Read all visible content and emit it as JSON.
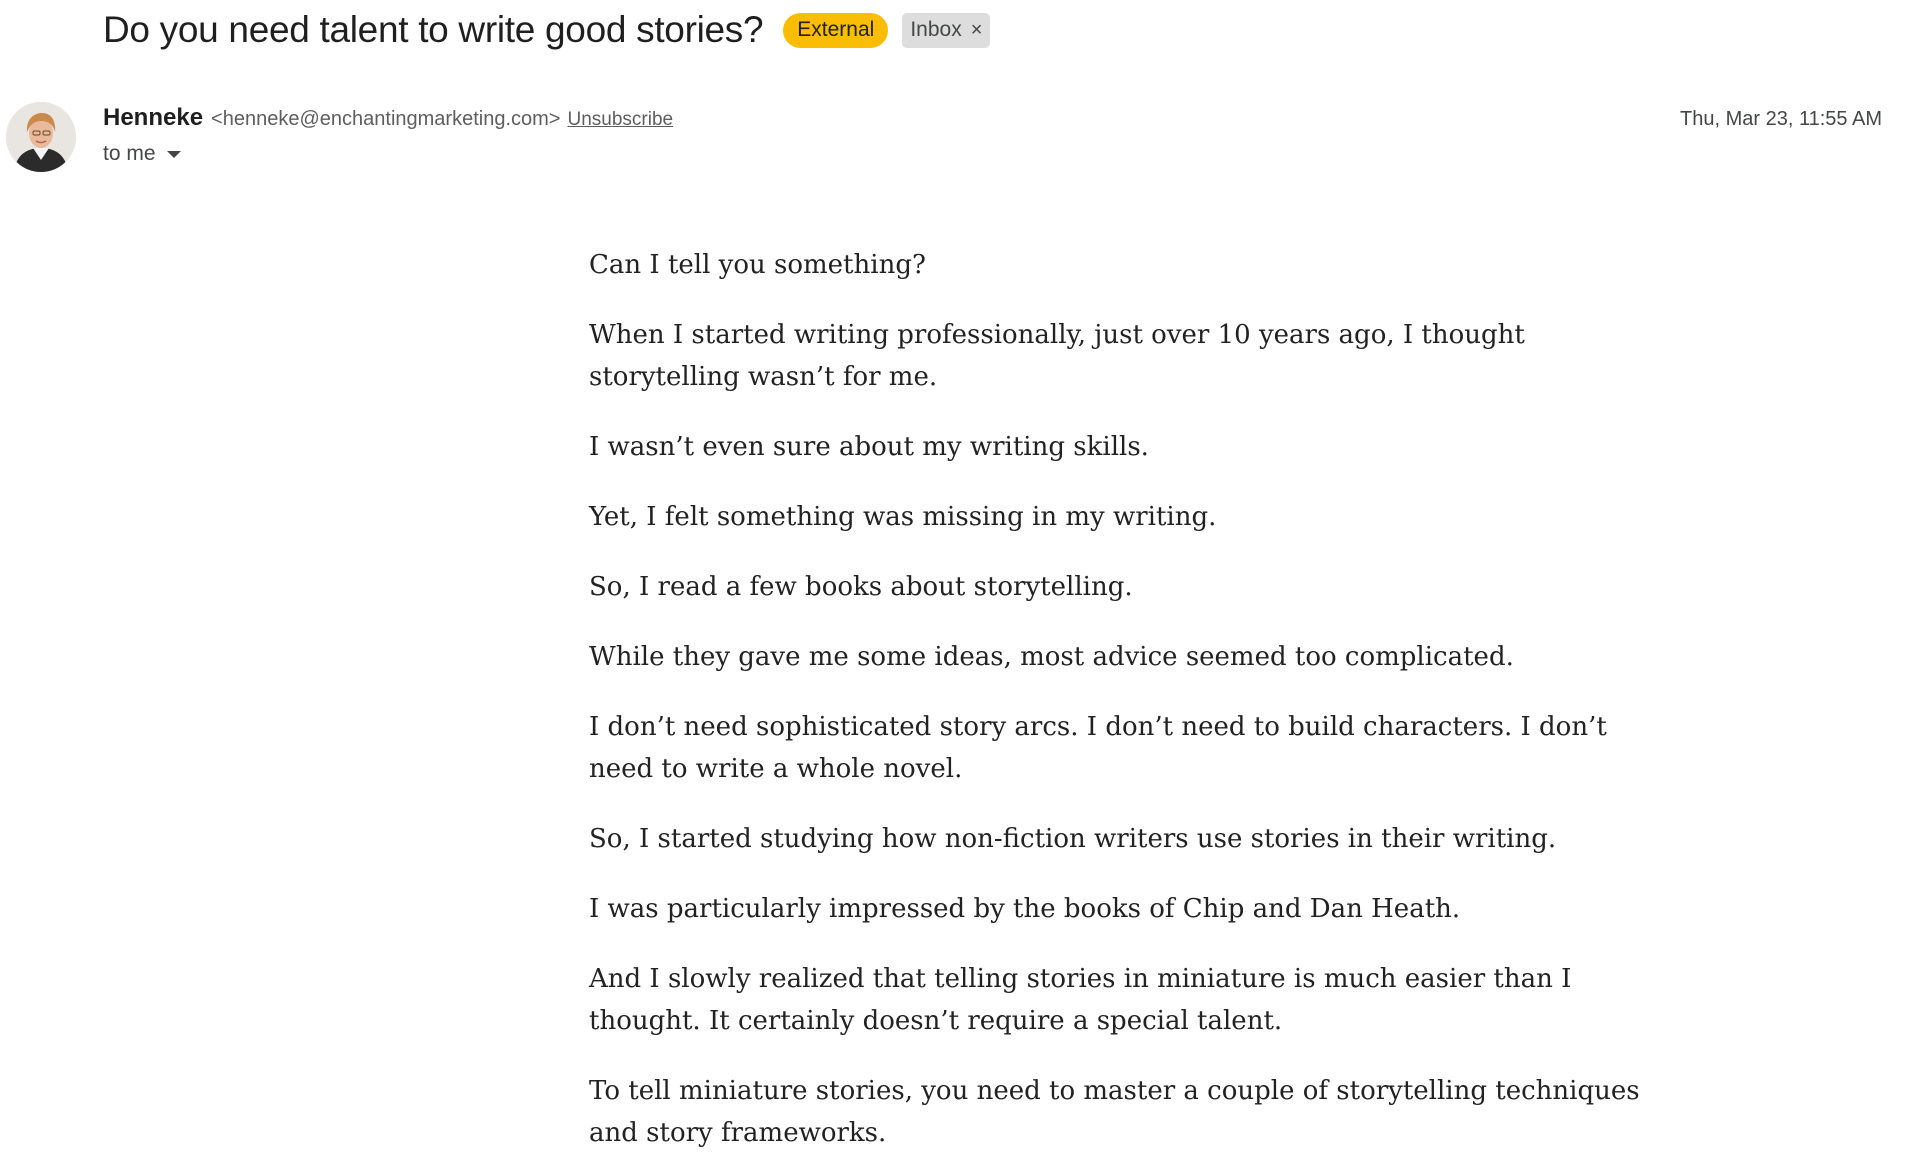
{
  "email": {
    "subject": "Do you need talent to write good stories?",
    "labels": {
      "external": "External",
      "inbox": "Inbox",
      "inbox_remove": "×"
    },
    "sender": {
      "name": "Henneke",
      "email": "<henneke@enchantingmarketing.com>",
      "unsubscribe": "Unsubscribe"
    },
    "date": "Thu, Mar 23, 11:55 AM",
    "recipient": "to me",
    "paragraphs": [
      "Can I tell you something?",
      "When I started writing professionally, just over 10 years ago, I thought storytelling wasn’t for me.",
      "I wasn’t even sure about my writing skills.",
      "Yet, I felt something was missing in my writing.",
      "So, I read a few books about storytelling.",
      "While they gave me some ideas, most advice seemed too complicated.",
      "I don’t need sophisticated story arcs. I don’t need to build characters. I don’t need to write a whole novel.",
      "So, I started studying how non-fiction writers use stories in their writing.",
      "I was particularly impressed by the books of Chip and Dan Heath.",
      "And I slowly realized that telling stories in miniature is much easier than I thought. It certainly doesn’t require a special talent.",
      "To tell miniature stories, you need to master a couple of storytelling techniques and story frameworks."
    ]
  },
  "colors": {
    "external_label": "#fbbc04",
    "inbox_label": "#dddddd",
    "text": "#1f1f1f"
  }
}
